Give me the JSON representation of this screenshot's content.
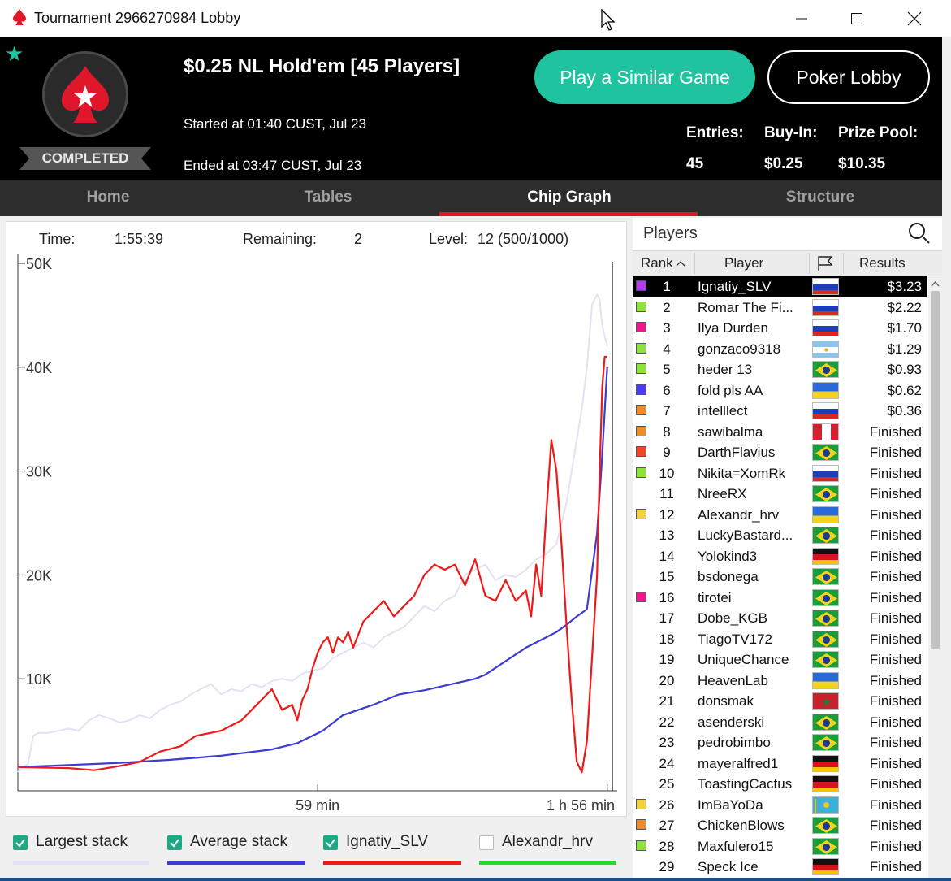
{
  "window": {
    "title": "Tournament 2966270984 Lobby"
  },
  "header": {
    "game_title": "$0.25 NL Hold'em [45 Players]",
    "started": "Started at 01:40 CUST, Jul 23",
    "ended": "Ended at 03:47 CUST, Jul 23",
    "status_badge": "COMPLETED",
    "play_similar_label": "Play a Similar Game",
    "poker_lobby_label": "Poker Lobby",
    "stats": [
      {
        "label": "Entries:",
        "value": "45"
      },
      {
        "label": "Buy-In:",
        "value": "$0.25"
      },
      {
        "label": "Prize Pool:",
        "value": "$10.35"
      }
    ]
  },
  "tabs": [
    {
      "label": "Home",
      "active": false
    },
    {
      "label": "Tables",
      "active": false
    },
    {
      "label": "Chip Graph",
      "active": true
    },
    {
      "label": "Structure",
      "active": false
    }
  ],
  "chart_header": {
    "time_label": "Time:",
    "time_value": "1:55:39",
    "remaining_label": "Remaining:",
    "remaining_value": "2",
    "level_label": "Level:",
    "level_value": "12 (500/1000)"
  },
  "chart_data": {
    "type": "line",
    "xlabel": "",
    "ylabel": "",
    "x_unit": "minutes",
    "xlim": [
      0,
      117
    ],
    "ylim": [
      0,
      50000
    ],
    "yticks": [
      10000,
      20000,
      30000,
      40000,
      50000
    ],
    "ytick_labels": [
      "10K",
      "20K",
      "30K",
      "40K",
      "50K"
    ],
    "xticks": [
      59,
      116
    ],
    "xtick_labels": [
      "59 min",
      "1 h 56 min"
    ],
    "grid": false,
    "legend_position": "bottom",
    "series": [
      {
        "name": "Largest stack",
        "color": "#e2e2f4",
        "checked": true,
        "x": [
          0,
          1,
          2,
          3,
          4,
          6,
          8,
          10,
          12,
          14,
          16,
          18,
          20,
          22,
          24,
          26,
          28,
          30,
          32,
          34,
          36,
          38,
          40,
          42,
          44,
          46,
          48,
          50,
          52,
          54,
          56,
          58,
          60,
          62,
          64,
          66,
          68,
          70,
          72,
          74,
          76,
          78,
          80,
          82,
          84,
          86,
          88,
          90,
          92,
          94,
          96,
          98,
          100,
          102,
          104,
          106,
          107,
          108,
          109,
          110,
          111,
          112,
          113,
          114,
          114.5,
          115,
          116
        ],
        "values": [
          1000,
          1500,
          1800,
          4500,
          4800,
          4800,
          5000,
          5200,
          5000,
          6000,
          6500,
          6200,
          5800,
          6000,
          6500,
          6200,
          7000,
          7500,
          7800,
          8500,
          9000,
          9500,
          8500,
          9000,
          8800,
          9500,
          9200,
          9800,
          10000,
          9800,
          10500,
          10800,
          11000,
          12000,
          12500,
          13000,
          13500,
          13000,
          14000,
          14500,
          15000,
          16000,
          17000,
          16500,
          17500,
          18000,
          20000,
          20500,
          21000,
          19500,
          20000,
          19800,
          20500,
          21500,
          22000,
          23000,
          25000,
          27000,
          30000,
          33000,
          36000,
          40000,
          46000,
          47000,
          46500,
          44000,
          42000
        ]
      },
      {
        "name": "Average stack",
        "color": "#3c3cd0",
        "checked": true,
        "x": [
          0,
          10,
          20,
          30,
          40,
          50,
          55,
          60,
          64,
          70,
          75,
          80,
          90,
          92,
          100,
          104,
          106,
          108,
          110,
          112,
          114,
          115,
          116
        ],
        "values": [
          1500,
          1700,
          1900,
          2200,
          2600,
          3200,
          3800,
          5000,
          6500,
          7500,
          8500,
          8900,
          10000,
          10400,
          13000,
          14000,
          14500,
          15200,
          16000,
          16700,
          24000,
          31500,
          40000
        ]
      },
      {
        "name": "Ignatiy_SLV",
        "color": "#ee1a1a",
        "checked": true,
        "x": [
          0,
          10,
          15,
          20,
          24,
          28,
          32,
          35,
          40,
          44,
          48,
          50,
          52,
          54,
          55,
          56,
          57,
          58,
          59,
          60,
          61,
          62,
          63,
          64,
          65,
          66,
          68,
          70,
          72,
          74,
          76,
          78,
          80,
          82,
          84,
          86,
          88,
          90,
          92,
          94,
          96,
          98,
          100,
          101,
          102,
          103,
          104,
          105,
          106,
          107,
          108,
          109,
          110,
          111,
          112,
          113,
          114,
          114.5,
          115,
          115.5,
          116
        ],
        "values": [
          1500,
          1400,
          1200,
          1600,
          2000,
          3000,
          3500,
          4500,
          5000,
          6000,
          8000,
          9000,
          7000,
          7500,
          6000,
          8000,
          9000,
          11000,
          12500,
          13500,
          14000,
          12500,
          14000,
          13500,
          14500,
          13000,
          15500,
          16500,
          17500,
          16000,
          17000,
          18000,
          20000,
          21000,
          20500,
          21000,
          19000,
          21500,
          18000,
          17500,
          19500,
          17500,
          18500,
          16000,
          21000,
          18000,
          26000,
          33000,
          30000,
          23000,
          15000,
          8000,
          2000,
          1000,
          4000,
          12000,
          20000,
          30000,
          38000,
          41000,
          41000
        ]
      },
      {
        "name": "Alexandr_hrv",
        "color": "#22dd22",
        "checked": false,
        "x": [],
        "values": []
      }
    ]
  },
  "players": {
    "title": "Players",
    "columns": {
      "rank": "Rank",
      "player": "Player",
      "results": "Results"
    },
    "rows": [
      {
        "rank": "1",
        "name": "Ignatiy_SLV",
        "flag": "ru",
        "result": "$3.23",
        "color": "#b43cf0",
        "selected": true
      },
      {
        "rank": "2",
        "name": "Romar The Fi...",
        "flag": "ru",
        "result": "$2.22",
        "color": "#8ee23c"
      },
      {
        "rank": "3",
        "name": "Ilya Durden",
        "flag": "ru",
        "result": "$1.70",
        "color": "#f0168c"
      },
      {
        "rank": "4",
        "name": "gonzaco9318",
        "flag": "ar",
        "result": "$1.29",
        "color": "#8ee23c"
      },
      {
        "rank": "5",
        "name": "heder 13",
        "flag": "br",
        "result": "$0.93",
        "color": "#8ee23c"
      },
      {
        "rank": "6",
        "name": "fold pls AA",
        "flag": "ua",
        "result": "$0.62",
        "color": "#4a3cf0"
      },
      {
        "rank": "7",
        "name": "intelllect",
        "flag": "ru",
        "result": "$0.36",
        "color": "#f08c28"
      },
      {
        "rank": "8",
        "name": "sawibalma",
        "flag": "pe",
        "result": "Finished",
        "color": "#f08c28"
      },
      {
        "rank": "9",
        "name": "DarthFlavius",
        "flag": "br",
        "result": "Finished",
        "color": "#f04628"
      },
      {
        "rank": "10",
        "name": "Nikita=XomRk",
        "flag": "ru",
        "result": "Finished",
        "color": "#8ee23c"
      },
      {
        "rank": "11",
        "name": "NreeRX",
        "flag": "br",
        "result": "Finished",
        "color": ""
      },
      {
        "rank": "12",
        "name": "Alexandr_hrv",
        "flag": "ua",
        "result": "Finished",
        "color": "#f0d23c"
      },
      {
        "rank": "13",
        "name": "LuckyBastard...",
        "flag": "br",
        "result": "Finished",
        "color": ""
      },
      {
        "rank": "14",
        "name": "Yolokind3",
        "flag": "de",
        "result": "Finished",
        "color": ""
      },
      {
        "rank": "15",
        "name": "bsdonega",
        "flag": "br",
        "result": "Finished",
        "color": ""
      },
      {
        "rank": "16",
        "name": "tirotei",
        "flag": "br",
        "result": "Finished",
        "color": "#f0168c"
      },
      {
        "rank": "17",
        "name": "Dobe_KGB",
        "flag": "br",
        "result": "Finished",
        "color": ""
      },
      {
        "rank": "18",
        "name": "TiagoTV172",
        "flag": "br",
        "result": "Finished",
        "color": ""
      },
      {
        "rank": "19",
        "name": "UniqueChance",
        "flag": "br",
        "result": "Finished",
        "color": ""
      },
      {
        "rank": "20",
        "name": "HeavenLab",
        "flag": "ua",
        "result": "Finished",
        "color": ""
      },
      {
        "rank": "21",
        "name": "donsmak",
        "flag": "ma",
        "result": "Finished",
        "color": ""
      },
      {
        "rank": "22",
        "name": "asenderski",
        "flag": "br",
        "result": "Finished",
        "color": ""
      },
      {
        "rank": "23",
        "name": "pedrobimbo",
        "flag": "br",
        "result": "Finished",
        "color": ""
      },
      {
        "rank": "24",
        "name": "mayeralfred1",
        "flag": "de",
        "result": "Finished",
        "color": ""
      },
      {
        "rank": "25",
        "name": "ToastingCactus",
        "flag": "de",
        "result": "Finished",
        "color": ""
      },
      {
        "rank": "26",
        "name": "ImBaYoDa",
        "flag": "kz",
        "result": "Finished",
        "color": "#f0d23c"
      },
      {
        "rank": "27",
        "name": "ChickenBlows",
        "flag": "br",
        "result": "Finished",
        "color": "#f08c28"
      },
      {
        "rank": "28",
        "name": "Maxfulero15",
        "flag": "br",
        "result": "Finished",
        "color": "#8ee23c"
      },
      {
        "rank": "29",
        "name": "Speck Ice",
        "flag": "de",
        "result": "Finished",
        "color": ""
      }
    ]
  }
}
